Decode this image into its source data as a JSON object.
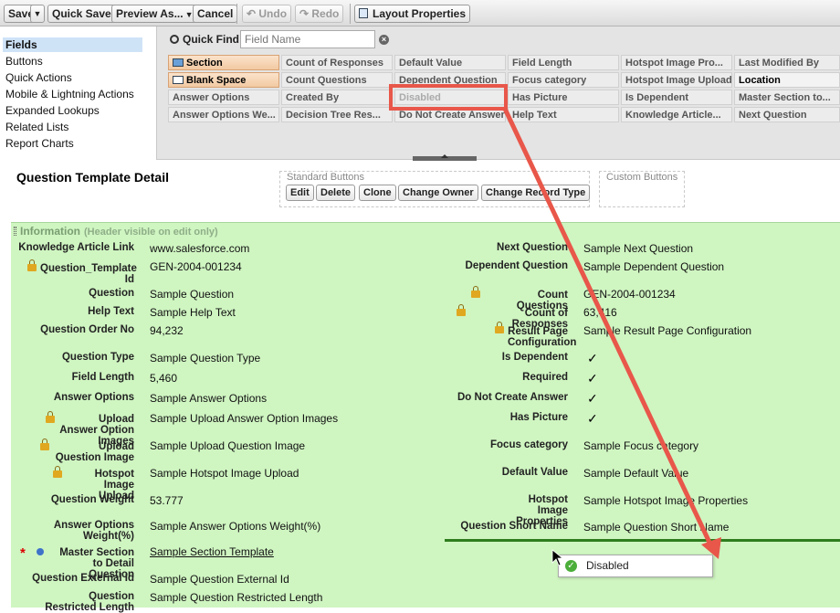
{
  "toolbar": {
    "save": "Save",
    "quick_save": "Quick Save",
    "preview_as": "Preview As...",
    "cancel": "Cancel",
    "undo": "Undo",
    "redo": "Redo",
    "layout_properties": "Layout Properties"
  },
  "categories": [
    "Fields",
    "Buttons",
    "Quick Actions",
    "Mobile & Lightning Actions",
    "Expanded Lookups",
    "Related Lists",
    "Report Charts"
  ],
  "quick_find": {
    "label": "Quick Find",
    "placeholder": "Field Name"
  },
  "palette": {
    "col1": [
      "Section",
      "Blank Space",
      "Answer Options",
      "Answer Options We..."
    ],
    "col2": [
      "Count of Responses",
      "Count Questions",
      "Created By",
      "Decision Tree Res..."
    ],
    "col3": [
      "Default Value",
      "Dependent Question",
      "Disabled",
      "Do Not Create Answer"
    ],
    "col4": [
      "Field Length",
      "Focus category",
      "Has Picture",
      "Help Text"
    ],
    "col5": [
      "Hotspot Image Pro...",
      "Hotspot Image Upload",
      "Is Dependent",
      "Knowledge Article..."
    ],
    "col6": [
      "Last Modified By",
      "Location",
      "Master Section to...",
      "Next Question"
    ]
  },
  "detail": {
    "title": "Question Template Detail",
    "standard_buttons_label": "Standard Buttons",
    "custom_buttons_label": "Custom Buttons",
    "buttons": [
      "Edit",
      "Delete",
      "Clone",
      "Change Owner",
      "Change Record Type"
    ]
  },
  "information": {
    "header": "Information",
    "subheader": "(Header visible on edit only)",
    "left": [
      {
        "label": "Knowledge Article Link",
        "value": "www.salesforce.com"
      },
      {
        "label": "Question_Template Id",
        "value": "GEN-2004-001234"
      },
      {
        "label": "Question",
        "value": "Sample Question"
      },
      {
        "label": "Help Text",
        "value": "Sample Help Text"
      },
      {
        "label": "Question Order No",
        "value": "94,232"
      },
      {
        "label": "Question Type",
        "value": "Sample Question Type"
      },
      {
        "label": "Field Length",
        "value": "5,460"
      },
      {
        "label": "Answer Options",
        "value": "Sample Answer Options"
      },
      {
        "label": "Upload Answer Option Images",
        "value": "Sample Upload Answer Option Images"
      },
      {
        "label": "Upload Question Image",
        "value": "Sample Upload Question Image"
      },
      {
        "label": "Hotspot Image Upload",
        "value": "Sample Hotspot Image Upload"
      },
      {
        "label": "Question Weight",
        "value": "53.777"
      },
      {
        "label": "Answer Options Weight(%)",
        "value": "Sample Answer Options Weight(%)"
      },
      {
        "label": "Master Section to Detail Question",
        "value": "Sample Section Template"
      },
      {
        "label": "Question External Id",
        "value": "Sample Question External Id"
      },
      {
        "label": "Question Restricted Length",
        "value": "Sample Question Restricted Length"
      }
    ],
    "right": [
      {
        "label": "Next Question",
        "value": "Sample Next Question"
      },
      {
        "label": "Dependent Question",
        "value": "Sample Dependent Question"
      },
      {
        "label": "Count Questions",
        "value": "GEN-2004-001234"
      },
      {
        "label": "Count of Responses",
        "value": "63,416"
      },
      {
        "label": "Result Page Configuration",
        "value": "Sample Result Page Configuration"
      },
      {
        "label": "Is Dependent",
        "value": "✓"
      },
      {
        "label": "Required",
        "value": "✓"
      },
      {
        "label": "Do Not Create Answer",
        "value": "✓"
      },
      {
        "label": "Has Picture",
        "value": "✓"
      },
      {
        "label": "Focus category",
        "value": "Sample Focus category"
      },
      {
        "label": "Default Value",
        "value": "Sample Default Value"
      },
      {
        "label": "Hotspot Image Properties",
        "value": "Sample Hotspot Image Properties"
      },
      {
        "label": "Question Short Name",
        "value": "Sample Question Short Name"
      }
    ]
  },
  "drag_tooltip": "Disabled",
  "colors": {
    "info_bg": "#cff5c1",
    "annotation": "#e8574a",
    "selected_category": "#cfe3f7"
  }
}
